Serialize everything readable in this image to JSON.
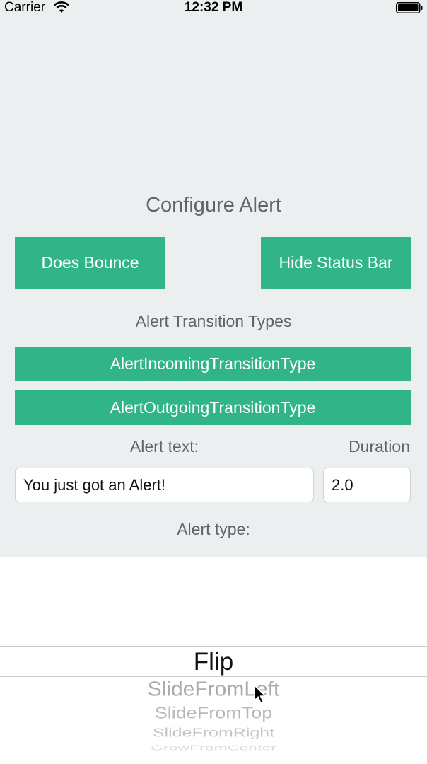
{
  "status_bar": {
    "carrier": "Carrier",
    "time": "12:32 PM"
  },
  "config": {
    "title": "Configure Alert",
    "does_bounce_label": "Does Bounce",
    "hide_status_bar_label": "Hide Status Bar",
    "transition_types_heading": "Alert Transition Types",
    "incoming_label": "AlertIncomingTransitionType",
    "outgoing_label": "AlertOutgoingTransitionType",
    "alert_text_label": "Alert text:",
    "duration_label": "Duration",
    "alert_text_value": "You just got an Alert!",
    "duration_value": "2.0",
    "alert_type_label": "Alert type:"
  },
  "picker": {
    "selected": "Flip",
    "items": [
      "SlideFromLeft",
      "SlideFromTop",
      "SlideFromRight",
      "GrowFromCenter"
    ]
  },
  "colors": {
    "accent": "#31b487",
    "background": "#eceff0"
  }
}
